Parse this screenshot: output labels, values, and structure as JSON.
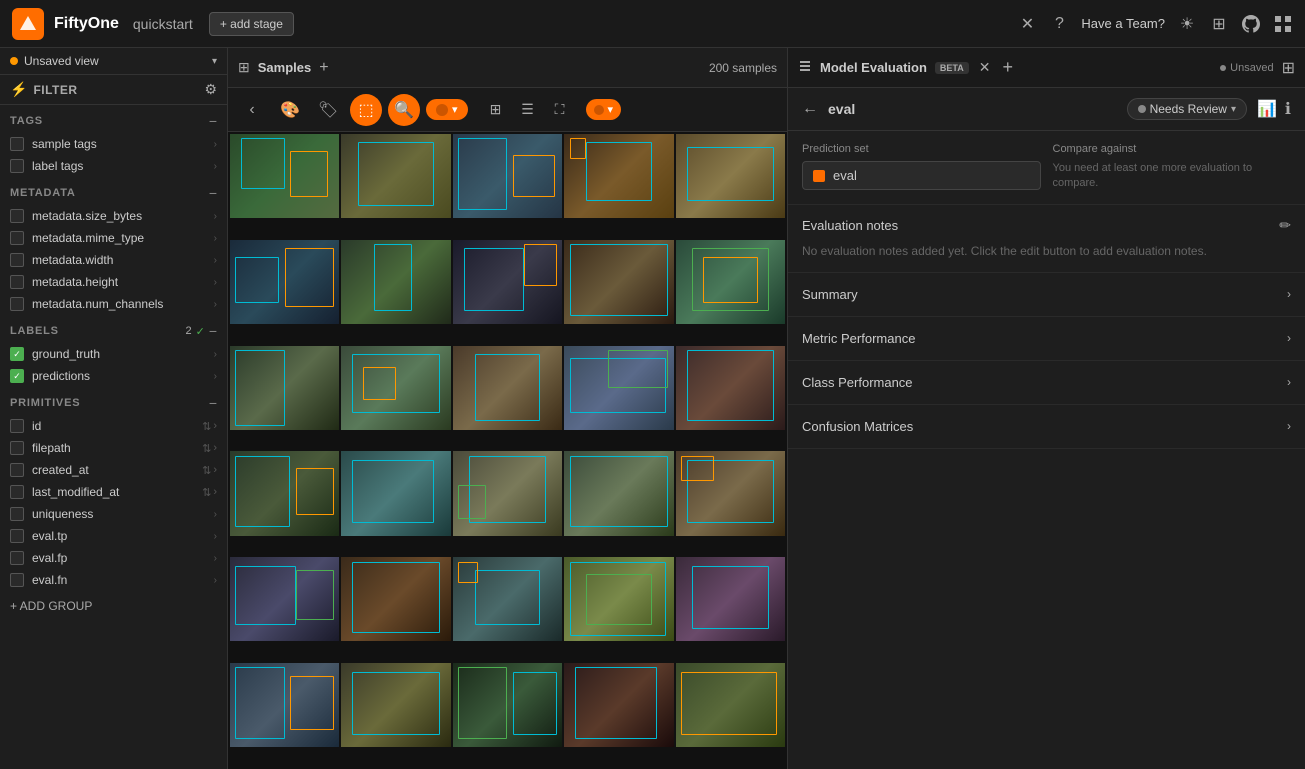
{
  "app": {
    "name": "FiftyOne",
    "context": "quickstart",
    "add_stage": "+ add stage"
  },
  "topbar": {
    "have_team": "Have a Team?",
    "close_icon": "✕",
    "help_icon": "?",
    "sun_icon": "☀",
    "github_icon": "⊕",
    "grid_icon": "⊞"
  },
  "sidebar": {
    "unsaved_view": "Unsaved view",
    "filter_label": "FILTER",
    "sections": {
      "tags": {
        "title": "TAGS",
        "items": [
          {
            "label": "sample tags",
            "checked": false
          },
          {
            "label": "label tags",
            "checked": false
          }
        ]
      },
      "metadata": {
        "title": "METADATA",
        "items": [
          {
            "label": "metadata.size_bytes",
            "checked": false
          },
          {
            "label": "metadata.mime_type",
            "checked": false
          },
          {
            "label": "metadata.width",
            "checked": false
          },
          {
            "label": "metadata.height",
            "checked": false
          },
          {
            "label": "metadata.num_channels",
            "checked": false
          }
        ]
      },
      "labels": {
        "title": "LABELS",
        "count": "2",
        "items": [
          {
            "label": "ground_truth",
            "checked": true
          },
          {
            "label": "predictions",
            "checked": true
          }
        ]
      },
      "primitives": {
        "title": "PRIMITIVES",
        "items": [
          {
            "label": "id",
            "has_icons": true
          },
          {
            "label": "filepath",
            "has_icons": true
          },
          {
            "label": "created_at",
            "has_icons": true
          },
          {
            "label": "last_modified_at",
            "has_icons": true
          },
          {
            "label": "uniqueness",
            "checked": false
          },
          {
            "label": "eval.tp",
            "checked": false
          },
          {
            "label": "eval.fp",
            "checked": false
          },
          {
            "label": "eval.fn",
            "checked": false
          }
        ]
      }
    },
    "add_group": "+ ADD GROUP"
  },
  "samples": {
    "title": "Samples",
    "count": "200 samples"
  },
  "right_panel": {
    "title": "Model Evaluation",
    "beta": "BETA",
    "unsaved": "Unsaved",
    "eval_name": "eval",
    "status": "Needs Review",
    "prediction_set_label": "Prediction set",
    "prediction_value": "eval",
    "compare_label": "Compare against",
    "compare_hint": "You need at least one more evaluation to compare.",
    "eval_notes_title": "Evaluation notes",
    "eval_notes_text": "No evaluation notes added yet. Click the edit button to add evaluation notes.",
    "sections": [
      {
        "id": "summary",
        "label": "Summary"
      },
      {
        "id": "metric_performance",
        "label": "Metric Performance"
      },
      {
        "id": "class_performance",
        "label": "Class Performance"
      },
      {
        "id": "confusion_matrices",
        "label": "Confusion Matrices"
      }
    ]
  }
}
